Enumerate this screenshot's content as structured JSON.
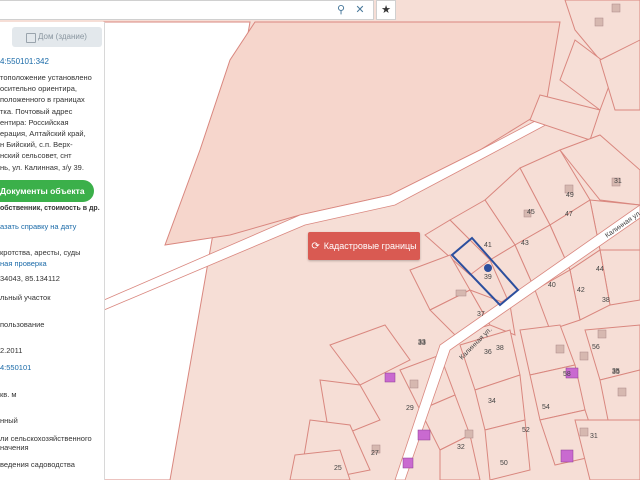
{
  "search": {
    "placeholder": "",
    "search_icon": "search-icon",
    "clear_icon": "close-icon",
    "favorite_icon": "star-icon"
  },
  "panel": {
    "tab_label": "Дом (здание)",
    "cad_number": "4:550101:342",
    "address_lines": [
      "тоположение установлено",
      "осительно ориентира,",
      "положенного в границах",
      "тка. Почтовый адрес",
      "ентира: Российская",
      "ерация, Алтайский край,",
      "н Бийский, с.п. Верх-",
      "нский сельсовет, снт",
      "нь, ул. Калинная, з/у 39."
    ],
    "docs_button": "Документы объекта",
    "docs_subtext": "обственник, стоимость в др.",
    "order_link": "азать справку на дату",
    "risks_label": "кротства, аресты, суды",
    "risks_link": "ная проверка",
    "coords": "34043, 85.134112",
    "type": "льный участок",
    "usage": "пользование",
    "date": "2.2011",
    "quarter": "4:550101",
    "area_unit": "кв. м",
    "status": "нный",
    "category_lines": [
      "ли сельскохозяйственного",
      "начения"
    ],
    "purpose": "ведения садоводства"
  },
  "map": {
    "cadastral_button": "Кадастровые границы",
    "parcel_numbers": [
      {
        "text": "49"
      },
      {
        "text": "47"
      },
      {
        "text": "45"
      },
      {
        "text": "43"
      },
      {
        "text": "41"
      },
      {
        "text": "39"
      },
      {
        "text": "44"
      },
      {
        "text": "42"
      },
      {
        "text": "40"
      },
      {
        "text": "38"
      },
      {
        "text": "37"
      },
      {
        "text": "36"
      },
      {
        "text": "35"
      },
      {
        "text": "34"
      },
      {
        "text": "33"
      },
      {
        "text": "32"
      },
      {
        "text": "31"
      },
      {
        "text": "29"
      },
      {
        "text": "27"
      },
      {
        "text": "25"
      },
      {
        "text": "52"
      },
      {
        "text": "54"
      },
      {
        "text": "56"
      },
      {
        "text": "50"
      },
      {
        "text": "31"
      },
      {
        "text": "33"
      },
      {
        "text": "35"
      },
      {
        "text": "38"
      },
      {
        "text": "58"
      }
    ],
    "street_labels": [
      "Калинная ул.",
      "Калинная ул."
    ],
    "colors": {
      "parcel_fill": "#f6ded6",
      "parcel_stroke": "#d9877f",
      "selected_stroke": "#2c4f9e",
      "building_fill": "#c96ad0",
      "button_bg": "#d95a52"
    }
  }
}
